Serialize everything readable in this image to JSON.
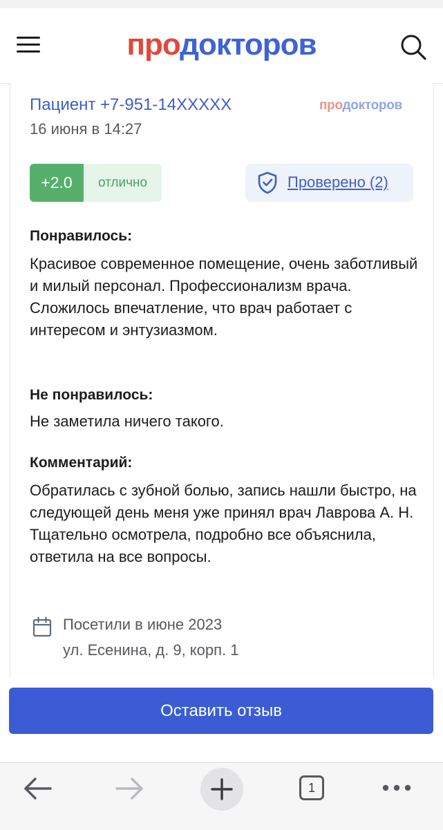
{
  "header": {
    "logo_part1": "про",
    "logo_part2": "докторов",
    "menu_icon": "hamburger-menu-icon",
    "search_icon": "search-icon"
  },
  "review": {
    "author": "Пациент +7-951-14XXXXX",
    "date": "16 июня в 14:27",
    "brand_part1": "про",
    "brand_part2": "докторов",
    "rating_value": "+2.0",
    "rating_label": "отлично",
    "verified_label": "Проверено (2)",
    "liked_title": "Понравилось:",
    "liked_text": "Красивое современное помещение, очень заботливый и милый персонал. Профессионализм врача. Сложилось впечатление, что врач работает с интересом и энтузиазмом.",
    "disliked_title": "Не понравилось:",
    "disliked_text": "Не заметила ничего такого.",
    "comment_title": "Комментарий:",
    "comment_text": "Обратилась с зубной болью, запись нашли быстро, на следующей день меня уже принял врач Лаврова А. Н. Тщательно осмотрела, подробно все объяснила, ответила на все вопросы.",
    "visit": "Посетили в июне 2023",
    "address": "ул. Есенина, д. 9, корп. 1"
  },
  "actions": {
    "leave_review": "Оставить отзыв"
  },
  "browser": {
    "tab_count": "1",
    "icons": [
      "back-arrow-icon",
      "forward-arrow-icon",
      "plus-icon",
      "tabs-icon",
      "more-icon"
    ]
  },
  "colors": {
    "brand_red": "#e2483a",
    "brand_blue": "#3e63d6",
    "link": "#3e5fc4",
    "rating_green": "#56b06c",
    "button_blue": "#3b5cd4"
  }
}
